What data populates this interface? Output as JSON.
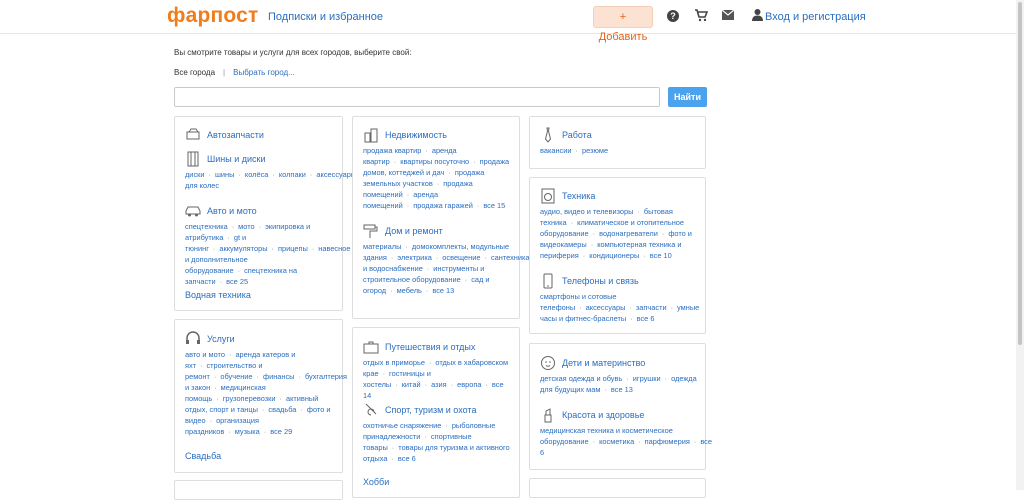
{
  "header": {
    "logo": "фарпост",
    "subscriptions": "Подписки и избранное",
    "add_button": "+ Добавить",
    "login": "Вход и регистрация"
  },
  "city": {
    "notice": "Вы смотрите товары и услуги для всех городов, выберите свой:",
    "current": "Все города",
    "separator": "|",
    "choose": "Выбрать город..."
  },
  "search": {
    "placeholder": "",
    "button": "Найти"
  },
  "categories": {
    "auto_parts": "Автозапчасти",
    "tires": {
      "title": "Шины и диски",
      "links": [
        "диски",
        "шины",
        "колёса",
        "колпаки",
        "аксессуары для колес"
      ]
    },
    "auto_moto": {
      "title": "Авто и мото",
      "links": [
        "спецтехника",
        "мото",
        "экипировка и атрибутика",
        "gt и тюнинг",
        "аккумуляторы",
        "прицепы",
        "навесное и дополнительное оборудование",
        "спецтехника на запчасти",
        "все 25"
      ]
    },
    "water": "Водная техника",
    "services": {
      "title": "Услуги",
      "links": [
        "авто и мото",
        "аренда катеров и яхт",
        "строительство и ремонт",
        "обучение",
        "финансы",
        "бухгалтерия",
        "юриспруденция и закон",
        "медицинская помощь",
        "грузоперевозки",
        "активный отдых, спорт и танцы",
        "свадьба",
        "фото и видео",
        "организация праздников",
        "музыка",
        "все 29"
      ]
    },
    "wedding": "Свадьба",
    "realty": {
      "title": "Недвижимость",
      "links": [
        "продажа квартир",
        "аренда квартир",
        "квартиры посуточно",
        "продажа домов, коттеджей и дач",
        "продажа земельных участков",
        "продажа помещений",
        "аренда помещений",
        "продажа гаражей",
        "все 15"
      ]
    },
    "home": {
      "title": "Дом и ремонт",
      "links": [
        "материалы",
        "домокомплекты, модульные здания",
        "электрика",
        "освещение",
        "сантехника и водоснабжение",
        "инструменты и строительное оборудование",
        "сад и огород",
        "мебель",
        "все 13"
      ]
    },
    "travel": {
      "title": "Путешествия и отдых",
      "links": [
        "отдых в приморье",
        "отдых в хабаровском крае",
        "гостиницы и хостелы",
        "китай",
        "азия",
        "европа",
        "все 14"
      ]
    },
    "sport": {
      "title": "Спорт, туризм и охота",
      "links": [
        "охотничье снаряжение",
        "рыболовные принадлежности",
        "спортивные товары",
        "товары для туризма и активного отдыха",
        "все 6"
      ]
    },
    "hobby": "Хобби",
    "work": {
      "title": "Работа",
      "links": [
        "вакансии",
        "резюме"
      ]
    },
    "tech": {
      "title": "Техника",
      "links": [
        "аудио, видео и телевизоры",
        "бытовая техника",
        "климатическое и отопительное оборудование",
        "водонагреватели",
        "фото и видеокамеры",
        "компьютерная техника и периферия",
        "кондиционеры",
        "все 10"
      ]
    },
    "phones": {
      "title": "Телефоны и связь",
      "links": [
        "смартфоны и сотовые телефоны",
        "аксессуары",
        "запчасти",
        "умные часы и фитнес-браслеты",
        "все 6"
      ]
    },
    "kids": {
      "title": "Дети и материнство",
      "links": [
        "детская одежда и обувь",
        "игрушки",
        "одежда для будущих мам",
        "все 13"
      ]
    },
    "beauty": {
      "title": "Красота и здоровье",
      "links": [
        "медицинская техника и косметическое оборудование",
        "косметика",
        "парфюмерия",
        "все 6"
      ]
    }
  },
  "colors": {
    "brand": "#f07d1b",
    "link": "#2a6ec0",
    "button": "#4aa3ec"
  }
}
